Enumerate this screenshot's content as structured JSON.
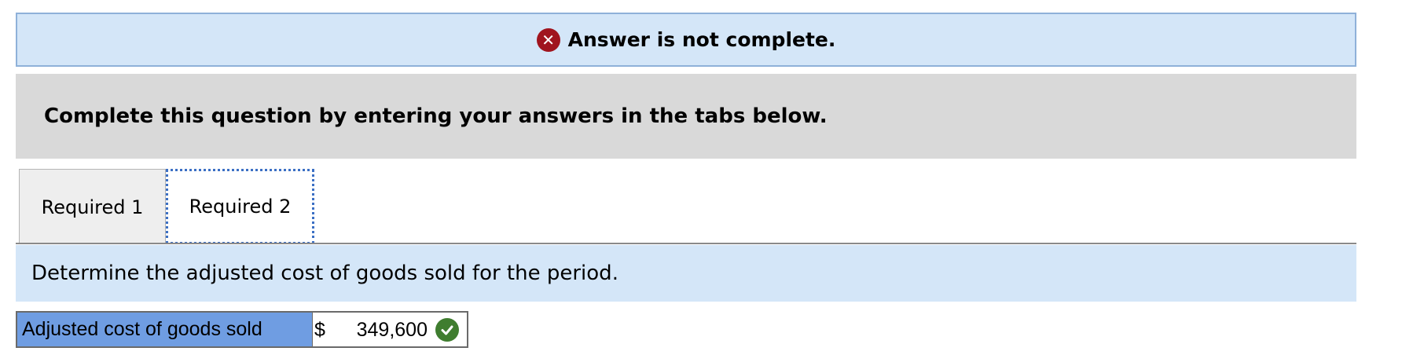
{
  "feedback": {
    "status_icon": "x-circle-icon",
    "message": "Answer is not complete.",
    "error_color": "#a0141e"
  },
  "instructions": {
    "text": "Complete this question by entering your answers in the tabs below."
  },
  "tabs": [
    {
      "label": "Required 1",
      "active": false
    },
    {
      "label": "Required 2",
      "active": true
    }
  ],
  "question": {
    "text": "Determine the adjusted cost of goods sold for the period."
  },
  "answer_row": {
    "label": "Adjusted cost of goods sold",
    "currency": "$",
    "value": "349,600",
    "status_icon": "check-circle-icon",
    "correct_color": "#3f7d2f"
  }
}
